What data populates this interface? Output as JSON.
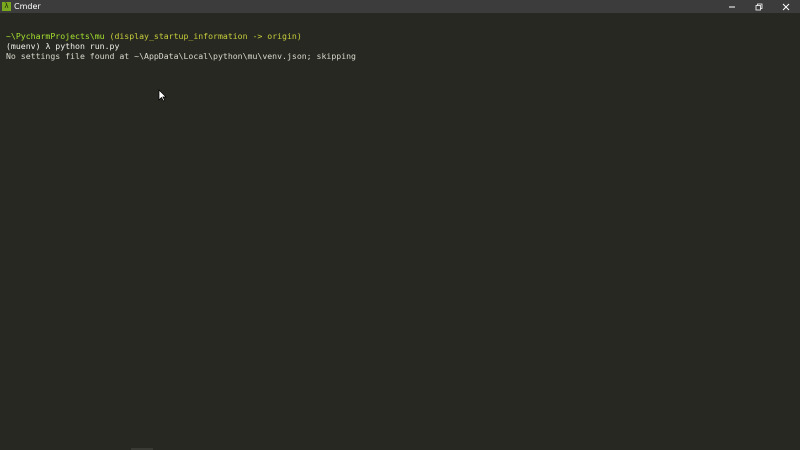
{
  "window": {
    "title": "Cmder",
    "app_icon_glyph": "λ",
    "controls": {
      "minimize": "minimize-icon",
      "restore": "restore-icon",
      "close": "close-icon"
    }
  },
  "terminal": {
    "prompt_path": "~\\PycharmProjects\\mu",
    "prompt_branch": " (display_startup_information -> origin)",
    "venv": "(muenv) ",
    "lambda": "λ ",
    "command": "python run.py",
    "output": "No settings file found at ~\\AppData\\Local\\python\\mu\\venv.json; skipping"
  },
  "colors": {
    "background": "#272822",
    "titlebar": "#3c3c3c",
    "path": "#a6e22e",
    "branch": "#c8cf3a",
    "text": "#f0f0e8"
  }
}
